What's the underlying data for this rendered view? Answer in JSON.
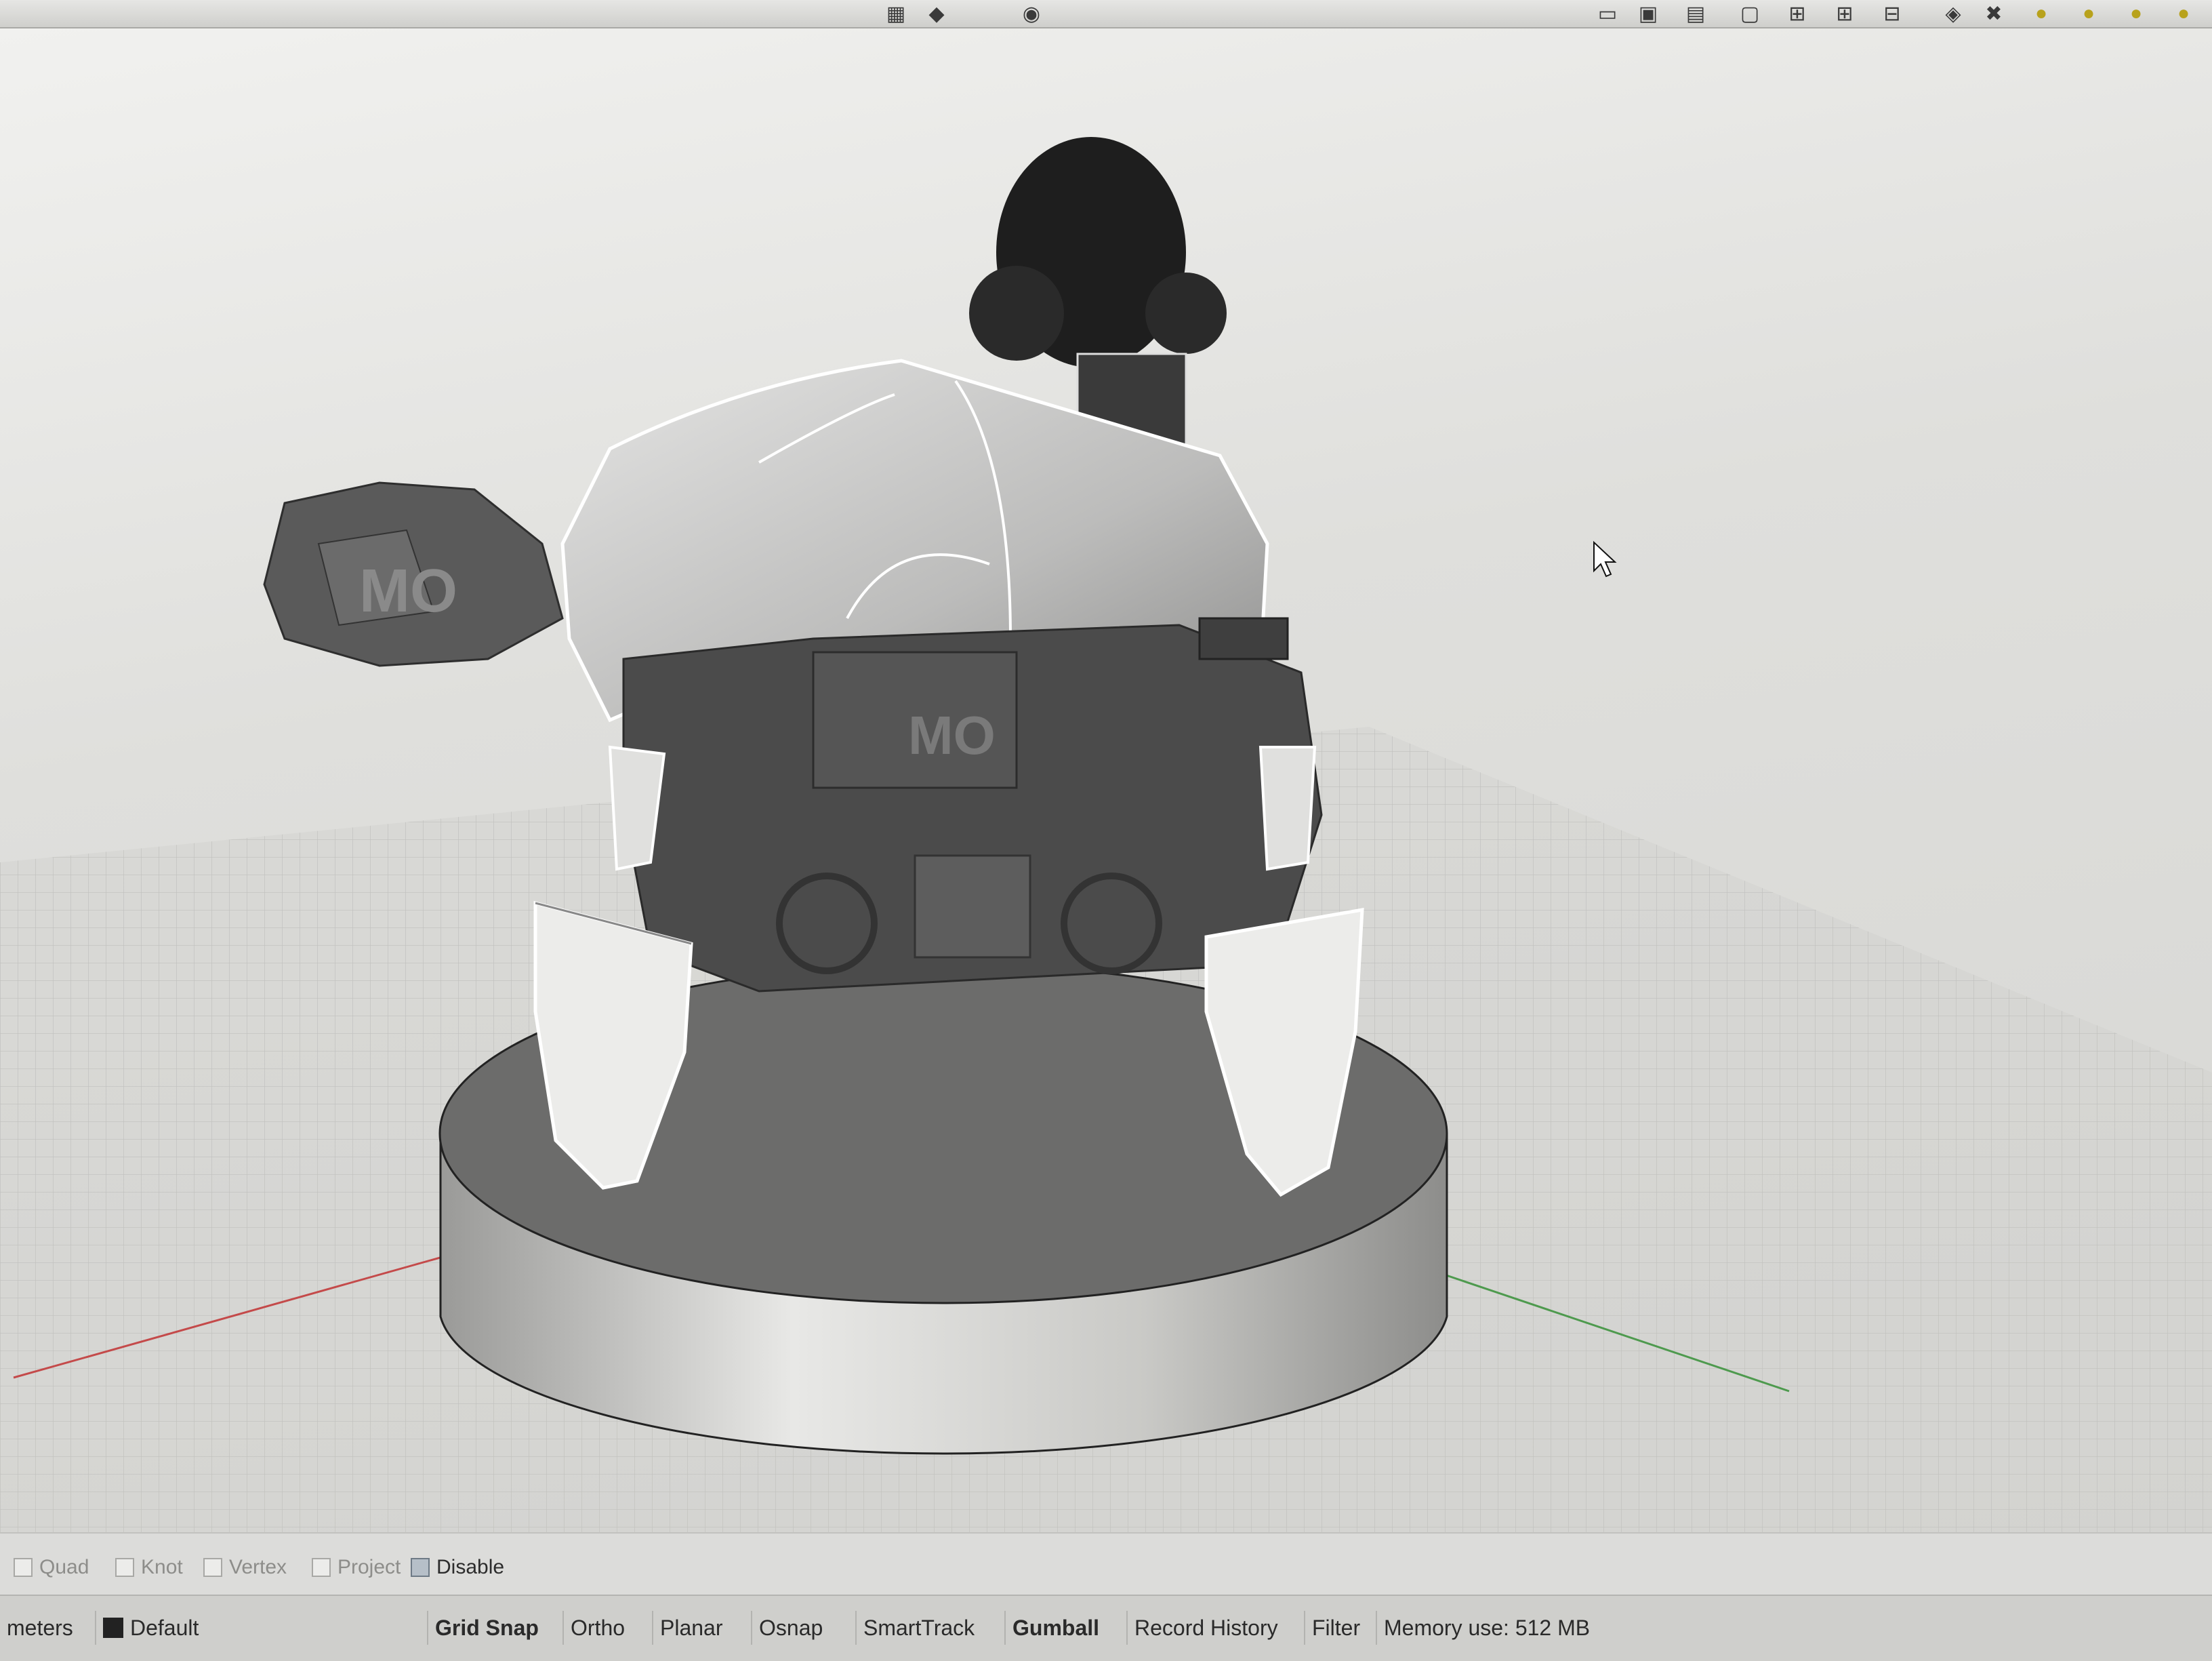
{
  "toolbar": {
    "icons": [
      "layer-icon",
      "grid-icon",
      "snap-icon",
      "mesh-icon",
      "lock-icon",
      "delete-icon",
      "light-icon",
      "light-icon",
      "light-icon",
      "light-icon"
    ]
  },
  "osnap": {
    "items": [
      {
        "label": "Quad",
        "checked": false
      },
      {
        "label": "Knot",
        "checked": false
      },
      {
        "label": "Vertex",
        "checked": false
      },
      {
        "label": "Project",
        "checked": false
      },
      {
        "label": "Disable",
        "checked": true
      }
    ]
  },
  "status": {
    "units": "meters",
    "layer": "Default",
    "layer_color": "#222222",
    "panes": [
      {
        "label": "Grid Snap",
        "active": true
      },
      {
        "label": "Ortho",
        "active": false
      },
      {
        "label": "Planar",
        "active": false
      },
      {
        "label": "Osnap",
        "active": false
      },
      {
        "label": "SmartTrack",
        "active": false
      },
      {
        "label": "Gumball",
        "active": true
      },
      {
        "label": "Record History",
        "active": false
      },
      {
        "label": "Filter",
        "active": false
      }
    ],
    "memory": "Memory use: 512 MB"
  }
}
